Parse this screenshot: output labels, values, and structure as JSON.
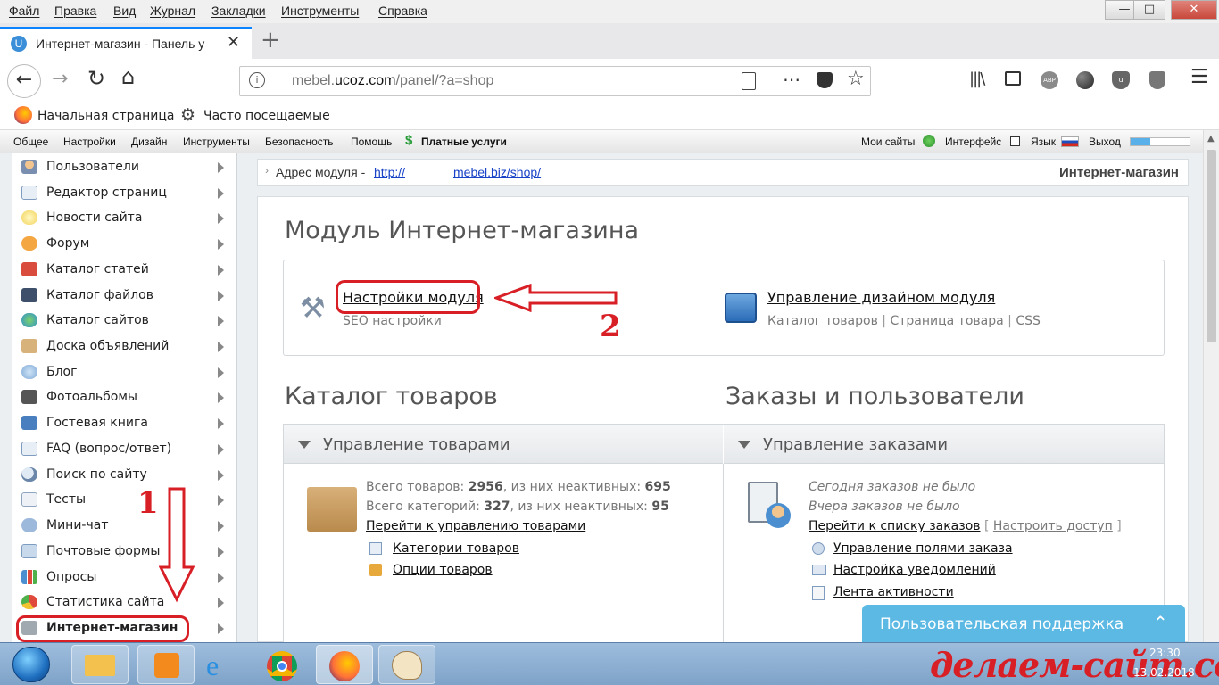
{
  "menubar": {
    "items": [
      "Файл",
      "Правка",
      "Вид",
      "Журнал",
      "Закладки",
      "Инструменты",
      "Справка"
    ]
  },
  "tab": {
    "title": "Интернет-магазин - Панель у",
    "favicon_letter": "U"
  },
  "urlbar": {
    "url_prefix": "mebel.",
    "url_domain": "ucoz.com",
    "url_path": "/panel/?a=shop"
  },
  "bookmarks": {
    "home": "Начальная страница",
    "frequent": "Часто посещаемые"
  },
  "panelnav": {
    "items": [
      "Общее",
      "Настройки",
      "Дизайн",
      "Инструменты",
      "Безопасность",
      "Помощь"
    ],
    "paid": "Платные услуги",
    "mysites": "Мои сайты",
    "interface": "Интерфейс",
    "language": "Язык",
    "logout": "Выход"
  },
  "sidebar": {
    "items": [
      "Пользователи",
      "Редактор страниц",
      "Новости сайта",
      "Форум",
      "Каталог статей",
      "Каталог файлов",
      "Каталог сайтов",
      "Доска объявлений",
      "Блог",
      "Фотоальбомы",
      "Гостевая книга",
      "FAQ (вопрос/ответ)",
      "Поиск по сайту",
      "Тесты",
      "Мини-чат",
      "Почтовые формы",
      "Опросы",
      "Статистика сайта",
      "Интернет-магазин"
    ]
  },
  "addr": {
    "label": "Адрес модуля - ",
    "link_start": "http://",
    "link_end": "mebel.biz/shop/",
    "module": "Интернет-магазин"
  },
  "module": {
    "title": "Модуль Интернет-магазина",
    "settings": "Настройки модуля",
    "seo": "SEO настройки",
    "design": "Управление дизайном модуля",
    "catalog_link": "Каталог товаров",
    "product_page": "Страница товара",
    "css": "CSS"
  },
  "catalog": {
    "title": "Каталог товаров",
    "box_title": "Управление товарами",
    "total_label": "Всего товаров: ",
    "total": "2956",
    "inactive_label": ", из них неактивных: ",
    "inactive": "695",
    "cats_label": "Всего категорий: ",
    "cats": "327",
    "cats_inactive": "95",
    "goto": "Перейти к управлению товарами",
    "categories": "Категории товаров",
    "options": "Опции товаров"
  },
  "orders": {
    "title": "Заказы и пользователи",
    "box_title": "Управление заказами",
    "today": "Сегодня заказов не было",
    "yesterday": "Вчера заказов не было",
    "goto": "Перейти к списку заказов",
    "access": "Настроить доступ",
    "fields": "Управление полями заказа",
    "notify": "Настройка уведомлений",
    "feed": "Лента активности"
  },
  "support": {
    "label": "Пользовательская поддержка"
  },
  "annotations": {
    "one": "1",
    "two": "2"
  },
  "taskbar": {
    "time": "23:30",
    "date": "13.02.2018"
  },
  "watermark": "делаем-сайт.com",
  "colors": {
    "accent": "#0a84ff",
    "red": "#d81f26",
    "support": "#5cb9e4"
  }
}
